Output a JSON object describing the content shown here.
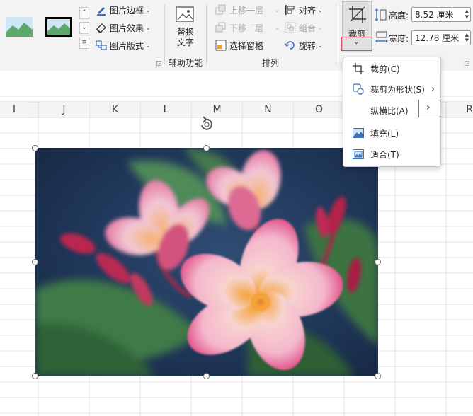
{
  "ribbon": {
    "picture_styles": {
      "border_label": "图片边框",
      "effects_label": "图片效果",
      "layout_label": "图片版式"
    },
    "accessibility": {
      "alt_text_line1": "替换",
      "alt_text_line2": "文字",
      "group_label": "辅助功能"
    },
    "arrange": {
      "bring_forward": "上移一层",
      "send_backward": "下移一层",
      "selection_pane": "选择窗格",
      "align": "对齐",
      "group": "组合",
      "rotate": "旋转",
      "group_label": "排列"
    },
    "size": {
      "crop_label": "裁剪",
      "height_label": "高度:",
      "height_value": "8.52 厘米",
      "width_label": "宽度:",
      "width_value": "12.78 厘米"
    }
  },
  "columns": [
    "I",
    "J",
    "K",
    "L",
    "M",
    "N",
    "O",
    "R"
  ],
  "crop_menu": {
    "items": [
      {
        "label": "裁剪(C)",
        "icon": "crop-icon"
      },
      {
        "label": "裁剪为形状(S)",
        "icon": "crop-to-shape-icon",
        "submenu": true
      },
      {
        "label": "纵横比(A)",
        "icon": "",
        "submenu": true
      },
      {
        "label": "填充(L)",
        "icon": "fill-icon"
      },
      {
        "label": "适合(T)",
        "icon": "fit-icon"
      }
    ]
  },
  "colors": {
    "highlight": "#e64a5a",
    "petal_pink": "#e97aa4",
    "petal_center": "#f5a13a",
    "leaf_green": "#3f7a46",
    "background_blue": "#1e3456"
  }
}
